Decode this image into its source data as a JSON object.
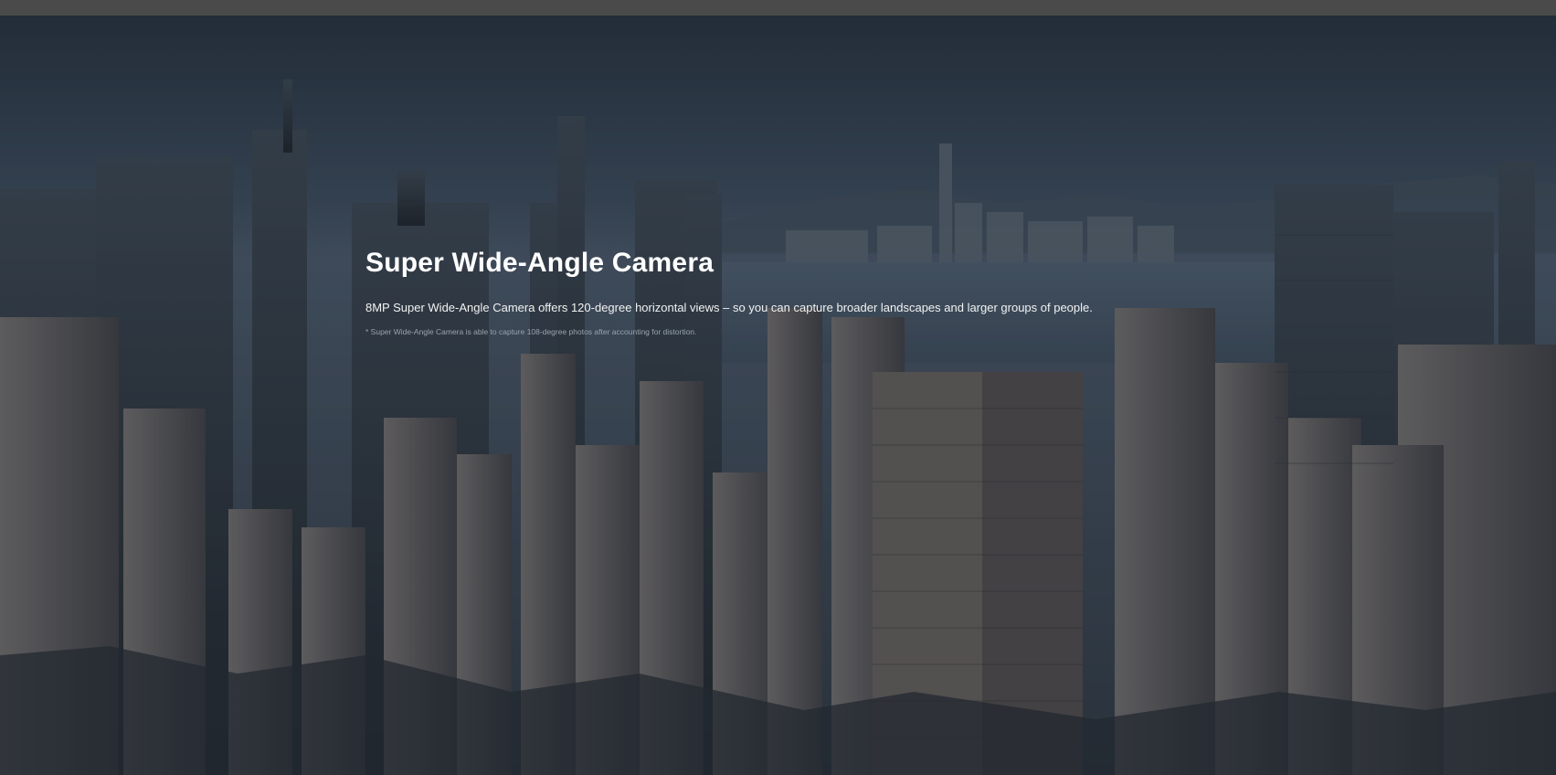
{
  "hero": {
    "title": "Super Wide-Angle Camera",
    "description": "8MP Super Wide-Angle Camera offers 120-degree horizontal views – so you can capture broader landscapes and larger groups of people.",
    "footnote": "* Super Wide-Angle Camera is able to capture 108-degree photos after accounting for distortion.",
    "background_image": "city-skyline-photo"
  },
  "colors": {
    "top_bar": "#4a4a4a",
    "title_text": "#ffffff",
    "footnote_text": "#9aa3ad"
  }
}
